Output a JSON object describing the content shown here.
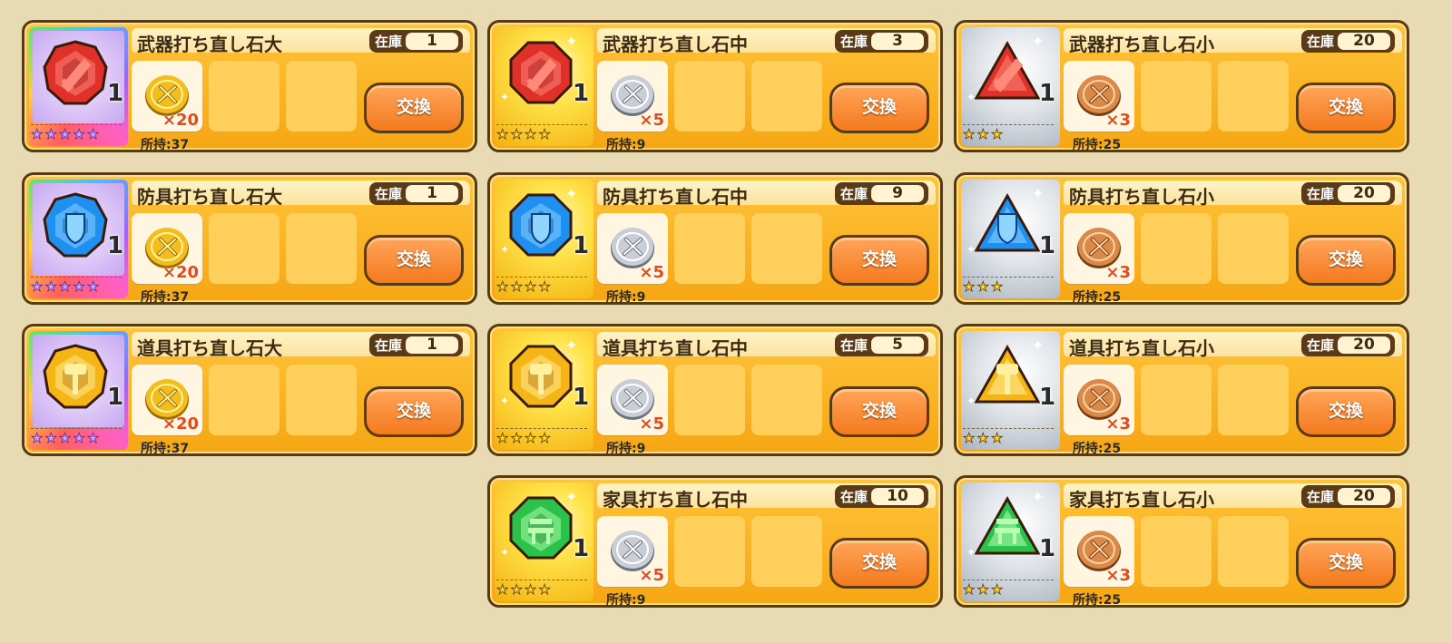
{
  "colors": {
    "background": "#e8dbb4",
    "card": "#f6a614",
    "button": "#f47a1e",
    "cost_text": "#e24a1a",
    "gem_red": "#e0302a",
    "gem_blue": "#1f8ff0",
    "gem_yellow": "#f5b514",
    "gem_green": "#2ac24a"
  },
  "labels": {
    "stock": "在庫",
    "exchange": "交換"
  },
  "cards": [
    {
      "name": "武器打ち直し石大",
      "stock": "1",
      "qty": "1",
      "rarity": "large",
      "stars": 5,
      "gem": "red",
      "coin": "gold",
      "cost": "×20",
      "owned": "所持:37",
      "icon": "sword-icon"
    },
    {
      "name": "武器打ち直し石中",
      "stock": "3",
      "qty": "1",
      "rarity": "medium",
      "stars": 4,
      "gem": "red",
      "coin": "silver",
      "cost": "×5",
      "owned": "所持:9",
      "icon": "sword-icon"
    },
    {
      "name": "武器打ち直し石小",
      "stock": "20",
      "qty": "1",
      "rarity": "small",
      "stars": 3,
      "gem": "red",
      "coin": "bronze",
      "cost": "×3",
      "owned": "所持:25",
      "icon": "sword-icon"
    },
    {
      "name": "防具打ち直し石大",
      "stock": "1",
      "qty": "1",
      "rarity": "large",
      "stars": 5,
      "gem": "blue",
      "coin": "gold",
      "cost": "×20",
      "owned": "所持:37",
      "icon": "shield-icon"
    },
    {
      "name": "防具打ち直し石中",
      "stock": "9",
      "qty": "1",
      "rarity": "medium",
      "stars": 4,
      "gem": "blue",
      "coin": "silver",
      "cost": "×5",
      "owned": "所持:9",
      "icon": "shield-icon"
    },
    {
      "name": "防具打ち直し石小",
      "stock": "20",
      "qty": "1",
      "rarity": "small",
      "stars": 3,
      "gem": "blue",
      "coin": "bronze",
      "cost": "×3",
      "owned": "所持:25",
      "icon": "shield-icon"
    },
    {
      "name": "道具打ち直し石大",
      "stock": "1",
      "qty": "1",
      "rarity": "large",
      "stars": 5,
      "gem": "yellow",
      "coin": "gold",
      "cost": "×20",
      "owned": "所持:37",
      "icon": "hammer-icon"
    },
    {
      "name": "道具打ち直し石中",
      "stock": "5",
      "qty": "1",
      "rarity": "medium",
      "stars": 4,
      "gem": "yellow",
      "coin": "silver",
      "cost": "×5",
      "owned": "所持:9",
      "icon": "hammer-icon"
    },
    {
      "name": "道具打ち直し石小",
      "stock": "20",
      "qty": "1",
      "rarity": "small",
      "stars": 3,
      "gem": "yellow",
      "coin": "bronze",
      "cost": "×3",
      "owned": "所持:25",
      "icon": "hammer-icon"
    },
    {
      "name": "家具打ち直し石中",
      "stock": "10",
      "qty": "1",
      "rarity": "medium",
      "stars": 4,
      "gem": "green",
      "coin": "silver",
      "cost": "×5",
      "owned": "所持:9",
      "icon": "furniture-icon"
    },
    {
      "name": "家具打ち直し石小",
      "stock": "20",
      "qty": "1",
      "rarity": "small",
      "stars": 3,
      "gem": "green",
      "coin": "bronze",
      "cost": "×3",
      "owned": "所持:25",
      "icon": "furniture-icon"
    }
  ]
}
